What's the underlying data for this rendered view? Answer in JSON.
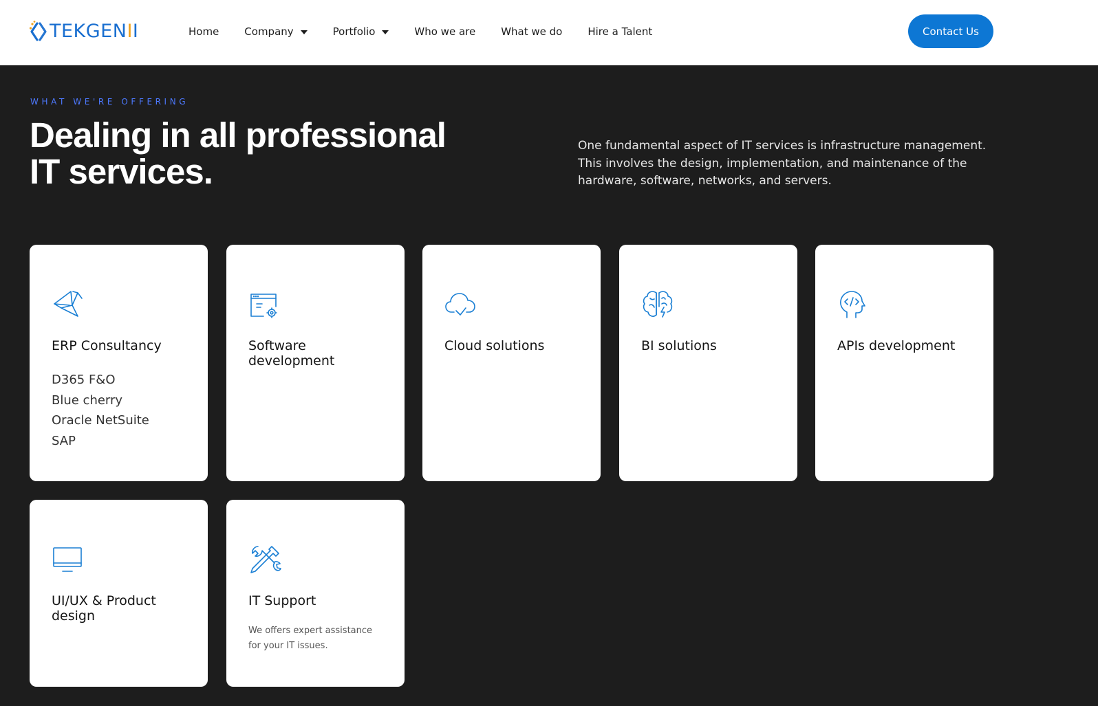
{
  "header": {
    "logo_text_main": "TEKGEN",
    "logo_text_accent": "I",
    "logo_text_end": "I",
    "nav": [
      {
        "label": "Home"
      },
      {
        "label": "Company"
      },
      {
        "label": "Portfolio"
      },
      {
        "label": "Who we are"
      },
      {
        "label": "What we do"
      },
      {
        "label": "Hire a Talent"
      }
    ],
    "contact_label": "Contact Us"
  },
  "hero": {
    "eyebrow": "What we're offering",
    "headline": "Dealing in all professional IT services.",
    "intro": "One fundamental aspect of IT services is infrastructure management. This involves the design, implementation, and maintenance of the hardware, software, networks, and servers."
  },
  "services": [
    {
      "title": "ERP Consultancy",
      "icon": "erp-network-icon",
      "items": [
        "D365 F&O",
        "Blue cherry",
        "Oracle NetSuite",
        "SAP"
      ]
    },
    {
      "title": "Software development",
      "icon": "browser-gear-icon"
    },
    {
      "title": "Cloud solutions",
      "icon": "cloud-check-icon"
    },
    {
      "title": "BI solutions",
      "icon": "brain-bolt-icon"
    },
    {
      "title": "APIs development",
      "icon": "head-code-icon"
    },
    {
      "title": "UI/UX & Product design",
      "icon": "monitor-icon"
    },
    {
      "title": "IT Support",
      "icon": "tools-icon",
      "description": "We offers expert assistance for your IT issues."
    }
  ],
  "colors": {
    "accent": "#0d77d4",
    "eyebrow": "#4d79ff",
    "background": "#1d1d1d",
    "icon": "#1a7fd4",
    "logo_accent": "#f0a21b"
  }
}
